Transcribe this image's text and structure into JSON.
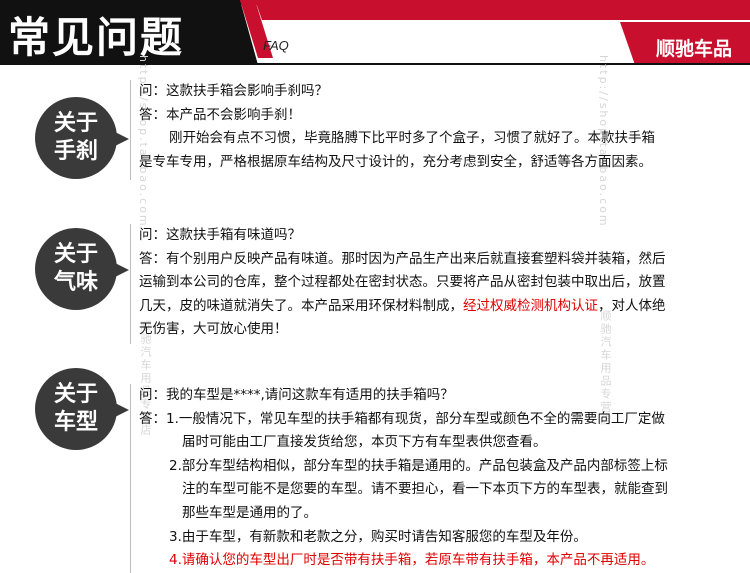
{
  "header": {
    "title": "常见问题",
    "subtitle": "FAQ",
    "brand": "顺驰车品"
  },
  "colors": {
    "accent": "#c8102e",
    "dark": "#111111",
    "bubble": "#3a3a3a",
    "highlight": "#e00000"
  },
  "watermark": {
    "left": "http://shop.taobao.com",
    "right": "http://shop.taobao.com",
    "right_brand": "顺驰汽车用品专营店",
    "left_brand": "顺驰汽车用品专营店"
  },
  "faq": [
    {
      "bubble": [
        "关于",
        "手刹"
      ],
      "question": "问：这款扶手箱会影响手刹吗？",
      "answer_lines": [
        "答：本产品不会影响手刹！",
        "刚开始会有点不习惯，毕竟胳膊下比平时多了个盒子，习惯了就好了。本款扶手箱",
        "是专车专用，严格根据原车结构及尺寸设计的，充分考虑到安全，舒适等各方面因素。"
      ]
    },
    {
      "bubble": [
        "关于",
        "气味"
      ],
      "question": "问：这款扶手箱有味道吗？",
      "answer_lines": [
        "答：有个别用户反映产品有味道。那时因为产品生产出来后就直接套塑料袋并装箱，然后",
        "运输到本公司的仓库，整个过程都处在密封状态。只要将产品从密封包装中取出后，放置",
        "几天，皮的味道就消失了。本产品采用环保材料制成，",
        "无伤害，大可放心使用！"
      ],
      "highlight": "经过权威检测机构认证",
      "after_highlight": "，对人体绝"
    },
    {
      "bubble": [
        "关于",
        "车型"
      ],
      "question": "问：我的车型是****,请问这款车有适用的扶手箱吗？",
      "answer_lines": [
        "答：1.一般情况下，常见车型的扶手箱都有现货，部分车型或颜色不全的需要向工厂定做",
        "届时可能由工厂直接发货给您，本页下方有车型表供您查看。",
        "2.部分车型结构相似，部分车型的扶手箱是通用的。产品包装盒及产品内部标签上标",
        "注的车型可能不是您要的车型。请不要担心，看一下本页下方的车型表，就能查到",
        "那些车型是通用的了。",
        "3.由于车型，有新款和老款之分，购买时请告知客服您的车型及年份。",
        "4.请确认您的车型出厂时是否带有扶手箱，若原车带有扶手箱，本产品不再适用。"
      ]
    }
  ]
}
